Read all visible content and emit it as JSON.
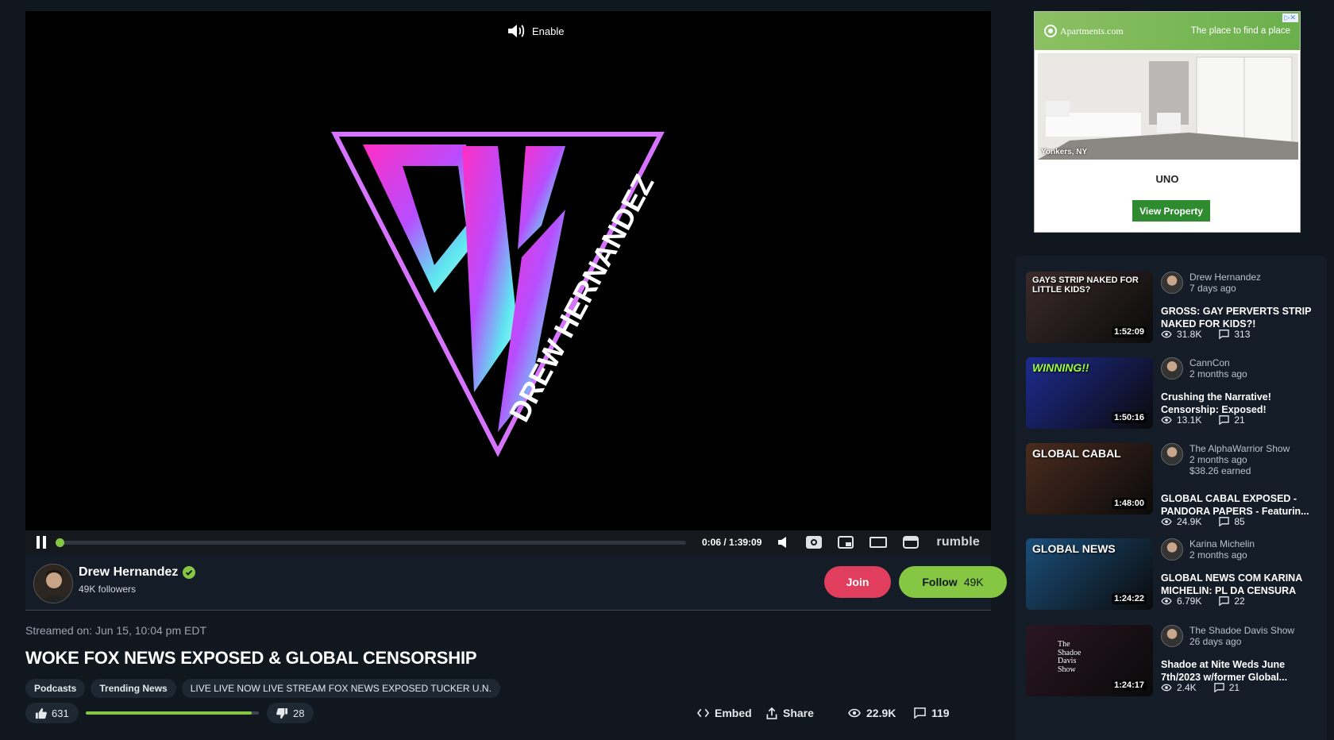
{
  "player": {
    "enable_label": "Enable",
    "logo_text": "DREW HERNANDEZ",
    "time": "0:06 / 1:39:09",
    "progress": 0.0,
    "brand": "rumble"
  },
  "channel": {
    "name": "Drew Hernandez",
    "followers": "49K followers",
    "join_label": "Join",
    "follow_label": "Follow",
    "follow_count": "49K"
  },
  "video": {
    "streamed": "Streamed on: Jun 15, 10:04 pm EDT",
    "title": "WOKE FOX NEWS EXPOSED & GLOBAL CENSORSHIP",
    "tags": [
      "Podcasts",
      "Trending News",
      "LIVE LIVE NOW LIVE STREAM FOX NEWS EXPOSED TUCKER U.N."
    ],
    "likes": "631",
    "dislikes": "28",
    "like_ratio": 0.957,
    "embed_label": "Embed",
    "share_label": "Share",
    "views": "22.9K",
    "comments": "119"
  },
  "ad": {
    "brand": "Apartments.com",
    "tagline": "The place to find a place",
    "location": "Yonkers, NY",
    "property_name": "UNO",
    "cta": "View Property"
  },
  "related": [
    {
      "channel": "Drew Hernandez",
      "age": "7 days ago",
      "earned": "",
      "title": "GROSS: GAY PERVERTS STRIP NAKED FOR KIDS?!",
      "duration": "1:52:09",
      "views": "31.8K",
      "comments": "313",
      "thumb_text": "GAYS STRIP NAKED FOR LITTLE KIDS?",
      "thumb_color": "#3b2a2a"
    },
    {
      "channel": "CannCon",
      "age": "2 months ago",
      "earned": "",
      "title": "Crushing the Narrative! Censorship: Exposed!",
      "duration": "1:50:16",
      "views": "13.1K",
      "comments": "21",
      "thumb_text": "WINNING!!",
      "thumb_color": "#1d2b8f"
    },
    {
      "channel": "The AlphaWarrior Show",
      "age": "2 months ago",
      "earned": "$38.26 earned",
      "title": "GLOBAL CABAL EXPOSED - PANDORA PAPERS - Featurin...",
      "duration": "1:48:00",
      "views": "24.9K",
      "comments": "85",
      "thumb_text": "GLOBAL CABAL",
      "thumb_color": "#4a2b1e"
    },
    {
      "channel": "Karina Michelin",
      "age": "2 months ago",
      "earned": "",
      "title": "GLOBAL NEWS COM KARINA MICHELIN: PL DA CENSURA",
      "duration": "1:24:22",
      "views": "6.79K",
      "comments": "22",
      "thumb_text": "GLOBAL NEWS",
      "thumb_color": "#1b4e7a"
    },
    {
      "channel": "The Shadoe Davis Show",
      "age": "26 days ago",
      "earned": "",
      "title": "Shadoe at Nite Weds June 7th/2023 w/former Global...",
      "duration": "1:24:17",
      "views": "2.4K",
      "comments": "21",
      "thumb_text": "The Shadoe Davis Show",
      "thumb_color": "#2a1624"
    }
  ],
  "colors": {
    "accent_green": "#85c742",
    "join_red": "#e13d5c",
    "page_bg": "#10171f"
  }
}
